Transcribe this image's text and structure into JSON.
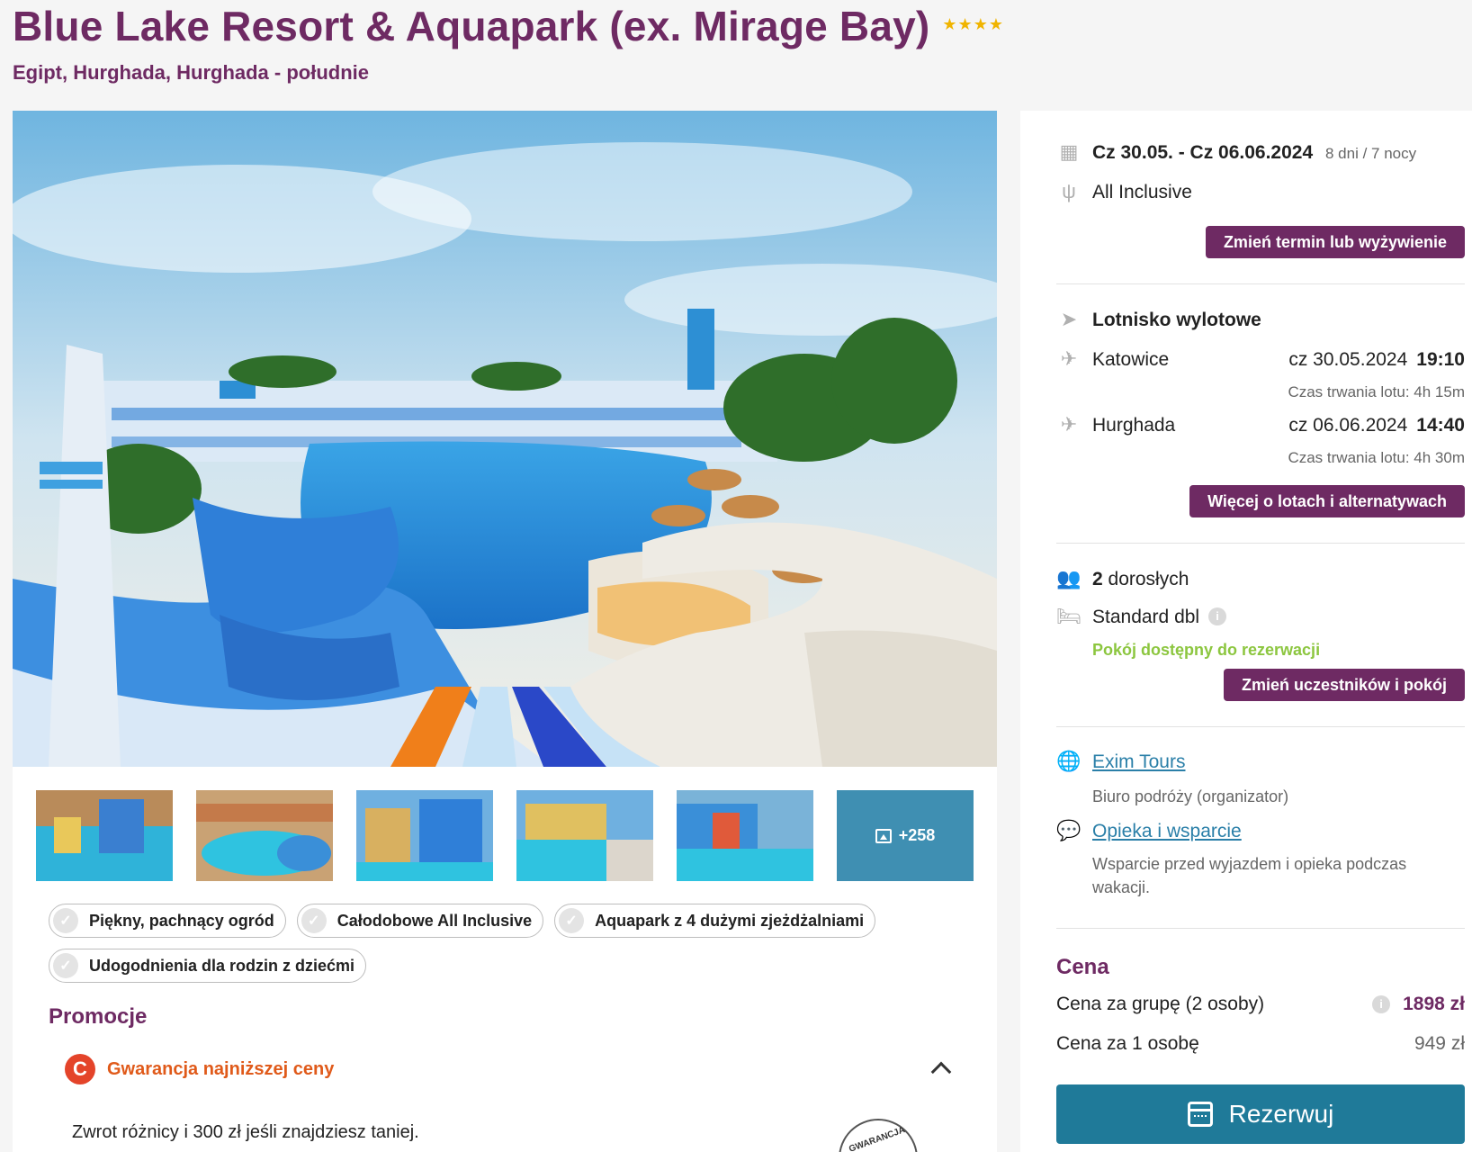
{
  "hotel": {
    "title": "Blue Lake Resort & Aquapark (ex. Mirage Bay)",
    "stars": "★★★★",
    "location": "Egipt, Hurghada, Hurghada - południe"
  },
  "gallery": {
    "more_count": "+258"
  },
  "features": [
    "Piękny, pachnący ogród",
    "Całodobowe All Inclusive",
    "Aquapark z 4 dużymi zjeżdżalniami",
    "Udogodnienia dla rodzin z dziećmi"
  ],
  "promotions": {
    "heading": "Promocje",
    "guarantee_icon": "C",
    "guarantee_label": "Gwarancja najniższej ceny",
    "description": "Zwrot różnicy i 300 zł jeśli znajdziesz taniej.",
    "seal_text": "GWARANCJA"
  },
  "booking": {
    "dates": "Cz 30.05. - Cz 06.06.2024",
    "duration": "8 dni / 7 nocy",
    "board": "All Inclusive",
    "change_term_button": "Zmień termin lub wyżywienie",
    "airport_heading": "Lotnisko wylotowe",
    "outbound": {
      "city": "Katowice",
      "date": "cz 30.05.2024",
      "time": "19:10",
      "duration": "Czas trwania lotu: 4h 15m"
    },
    "inbound": {
      "city": "Hurghada",
      "date": "cz 06.06.2024",
      "time": "14:40",
      "duration": "Czas trwania lotu: 4h 30m"
    },
    "flights_button": "Więcej o lotach i alternatywach",
    "travellers_count": "2",
    "travellers_label": "dorosłych",
    "room": "Standard dbl",
    "room_status": "Pokój dostępny do rezerwacji",
    "change_participants_button": "Zmień uczestników i pokój",
    "organizer_link": "Exim Tours",
    "organizer_desc": "Biuro podróży (organizator)",
    "support_link": "Opieka i wsparcie",
    "support_desc_1": "Wsparcie przed wyjazdem i opieka podczas",
    "support_desc_2": "wakacji."
  },
  "price": {
    "heading": "Cena",
    "group_label": "Cena za grupę (2 osoby)",
    "group_value": "1898 zł",
    "person_label": "Cena za 1 osobę",
    "person_value": "949 zł",
    "reserve_button": "Rezerwuj"
  },
  "colors": {
    "brand_purple": "#6e2a63",
    "reserve_teal": "#1f7a99",
    "available_green": "#8cc63f",
    "promo_orange": "#e05a1a",
    "star_gold": "#f0b400"
  }
}
